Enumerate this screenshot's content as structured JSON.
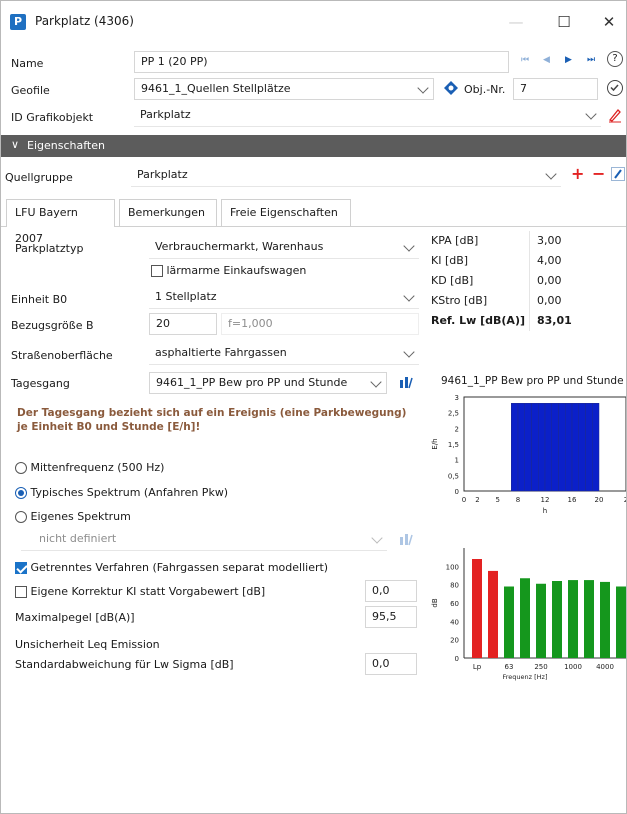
{
  "window": {
    "title": "Parkplatz (4306)",
    "app_icon_letter": "P",
    "minimize": "—",
    "maximize": "☐",
    "close": "✕"
  },
  "form": {
    "name_label": "Name",
    "name_value": "PP 1 (20 PP)",
    "geofile_label": "Geofile",
    "geofile_value": "9461_1_Quellen Stellplätze",
    "objnr_label": "Obj.-Nr.",
    "objnr_value": "7",
    "id_label": "ID Grafikobjekt",
    "id_value": "Parkplatz"
  },
  "section": {
    "title": "Eigenschaften"
  },
  "quellgruppe": {
    "label": "Quellgruppe",
    "value": "Parkplatz",
    "plus": "+",
    "minus": "−"
  },
  "tabs": [
    {
      "label": "LFU Bayern 2007"
    },
    {
      "label": "Bemerkungen"
    },
    {
      "label": "Freie Eigenschaften"
    }
  ],
  "props": {
    "parkplatztyp_label": "Parkplatztyp",
    "parkplatztyp_value": "Verbrauchermarkt, Warenhaus",
    "laermarm_label": "lärmarme Einkaufswagen",
    "einheit_label": "Einheit B0",
    "einheit_value": "1 Stellplatz",
    "bezug_label": "Bezugsgröße B",
    "bezug_value": "20",
    "bezug_f": "f=1,000",
    "strasse_label": "Straßenoberfläche",
    "strasse_value": "asphaltierte Fahrgassen",
    "tagesgang_label": "Tagesgang",
    "tagesgang_value": "9461_1_PP Bew pro PP und Stunde",
    "note": "Der Tagesgang bezieht sich auf ein Ereignis (eine Parkbewegung) je Einheit B0 und Stunde [E/h]!",
    "radio_mitten": "Mittenfrequenz (500 Hz)",
    "radio_typisch": "Typisches Spektrum (Anfahren Pkw)",
    "radio_eigen": "Eigenes Spektrum",
    "eigen_value": "nicht definiert",
    "getrennt_label": "Getrenntes Verfahren (Fahrgassen separat modelliert)",
    "korrektur_label": "Eigene Korrektur KI statt Vorgabewert [dB]",
    "korrektur_value": "0,0",
    "maxpegel_label": "Maximalpegel [dB(A)]",
    "maxpegel_value": "95,5",
    "unsicher_label": "Unsicherheit Leq Emission",
    "sigma_label": "Standardabweichung für Lw Sigma [dB]",
    "sigma_value": "0,0"
  },
  "kvtable": [
    {
      "k": "KPA [dB]",
      "v": "3,00"
    },
    {
      "k": "KI [dB]",
      "v": "4,00"
    },
    {
      "k": "KD [dB]",
      "v": "0,00"
    },
    {
      "k": "KStro [dB]",
      "v": "0,00"
    },
    {
      "k": "Ref. Lw  [dB(A)]",
      "v": "83,01"
    }
  ],
  "chart_data": [
    {
      "type": "bar",
      "title": "9461_1_PP Bew pro PP und Stunde",
      "xlabel": "h",
      "ylabel": "E/h",
      "x_ticks": [
        "0",
        "2",
        "5",
        "8",
        "12",
        "16",
        "20",
        "2"
      ],
      "y_ticks": [
        "0",
        "0,5",
        "1",
        "1,5",
        "2",
        "2,5",
        "3"
      ],
      "x": [
        7,
        8,
        9,
        10,
        11,
        12,
        13,
        14,
        15,
        16,
        17,
        18,
        19
      ],
      "values": [
        2.8,
        2.8,
        2.8,
        2.8,
        2.8,
        2.8,
        2.8,
        2.8,
        2.8,
        2.8,
        2.8,
        2.8,
        2.8
      ],
      "xlim": [
        0,
        24
      ],
      "ylim": [
        0,
        3
      ],
      "color": "#0b20c9"
    },
    {
      "type": "bar",
      "xlabel": "Frequenz [Hz]",
      "ylabel": "dB",
      "x_ticks": [
        "Lp",
        "63",
        "250",
        "1000",
        "4000"
      ],
      "y_ticks": [
        "0",
        "20",
        "40",
        "60",
        "80",
        "100"
      ],
      "values": [
        108,
        95,
        78,
        87,
        81,
        84,
        85,
        85,
        83,
        78,
        65
      ],
      "colors": [
        "#e32222",
        "#e32222",
        "#15971d",
        "#15971d",
        "#15971d",
        "#15971d",
        "#15971d",
        "#15971d",
        "#15971d",
        "#15971d",
        "#15971d"
      ],
      "ylim": [
        0,
        120
      ]
    }
  ]
}
